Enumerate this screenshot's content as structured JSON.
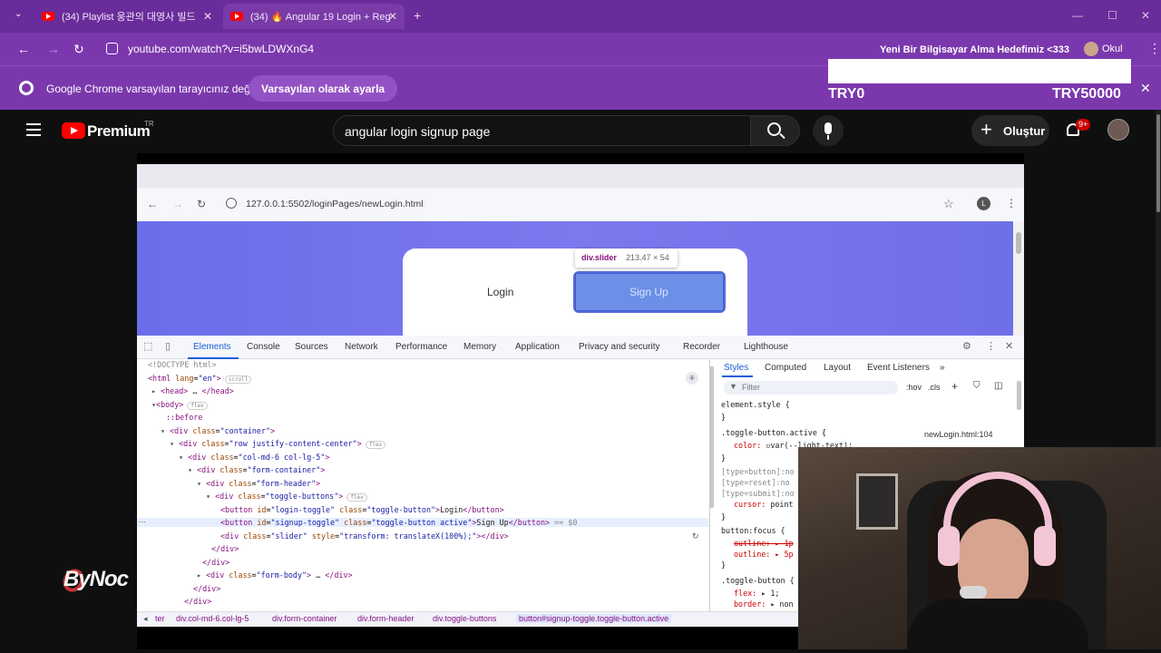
{
  "browser": {
    "tabs": [
      {
        "title": "(34) Playlist 웅관의 대영사 빌드"
      },
      {
        "title": "(34) 🔥 Angular 19 Login + Reg"
      }
    ],
    "new_tab": "+",
    "url": "youtube.com/watch?v=i5bwLDWXnG4",
    "overlay_title": "Yeni Bir Bilgisayar Alma Hedefimiz <333",
    "profile_label": "Okul"
  },
  "infobar": {
    "message": "Google Chrome varsayılan tarayıcınız değil",
    "button": "Varsayılan olarak ayarla"
  },
  "donation": {
    "left": "TRY0",
    "right": "TRY50000"
  },
  "youtube": {
    "brand": "Premium",
    "region": "TR",
    "search_value": "angular login signup page",
    "create_label": "Oluştur",
    "notifications": "9+"
  },
  "inner": {
    "url": "127.0.0.1:5502/loginPages/newLogin.html",
    "avatar": "L",
    "login_label": "Login",
    "signup_label": "Sign Up",
    "tooltip_name": "div.slider",
    "tooltip_size": "213.47 × 54"
  },
  "devtools": {
    "tabs": [
      "Elements",
      "Console",
      "Sources",
      "Network",
      "Performance",
      "Memory",
      "Application",
      "Privacy and security",
      "Recorder",
      "Lighthouse"
    ],
    "styles_tabs": [
      "Styles",
      "Computed",
      "Layout",
      "Event Listeners"
    ],
    "filter": "Filter",
    "hov": ":hov",
    "cls": ".cls",
    "source_link": "newLogin.html:104",
    "crumbs": [
      "ter",
      "div.col-md-6.col-lg-5",
      "div.form-container",
      "div.form-header",
      "div.toggle-buttons",
      "button#signup-toggle.toggle-button.active"
    ]
  },
  "watermark": "ByNoc"
}
